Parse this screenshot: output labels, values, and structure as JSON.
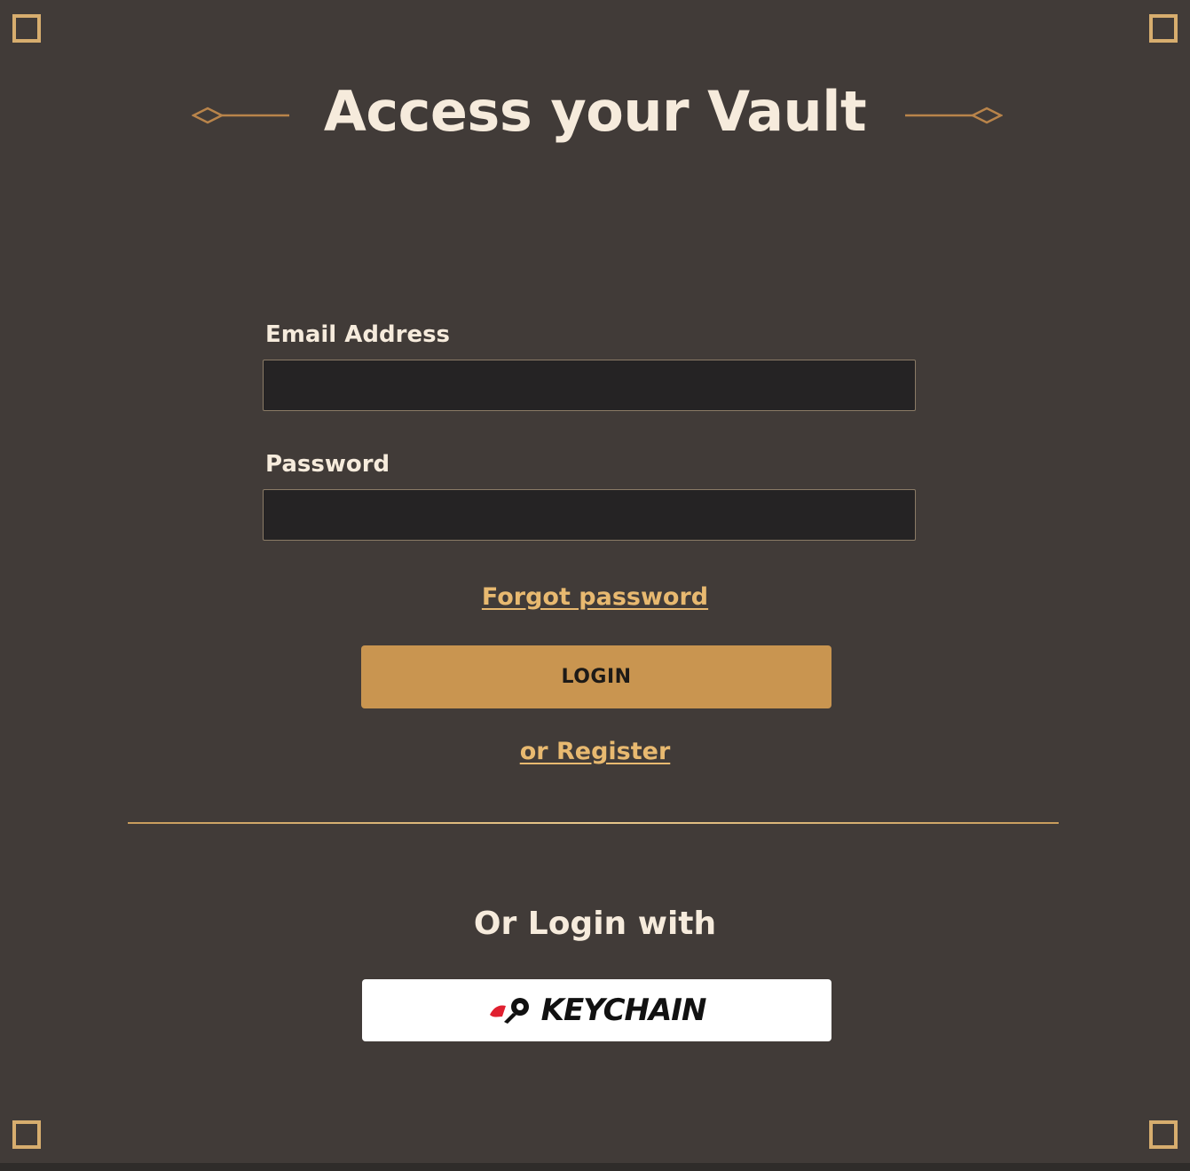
{
  "page": {
    "title": "Access your Vault"
  },
  "form": {
    "email_label": "Email Address",
    "email_value": "",
    "password_label": "Password",
    "password_value": "",
    "forgot_link": "Forgot password",
    "login_button": "LOGIN",
    "register_link": "or Register"
  },
  "social": {
    "heading": "Or Login with",
    "provider_logo": "KEYCHAIN"
  },
  "colors": {
    "panel_bg": "#413b38",
    "gold_accent": "#c99550",
    "link_gold": "#e8b970",
    "text_cream": "#f6ebdc",
    "input_bg": "#252324"
  },
  "icons": {
    "title_ornament_left": "diamond-line-ornament-icon",
    "title_ornament_right": "diamond-line-ornament-icon",
    "provider_logo_mark": "key-logo-icon"
  }
}
